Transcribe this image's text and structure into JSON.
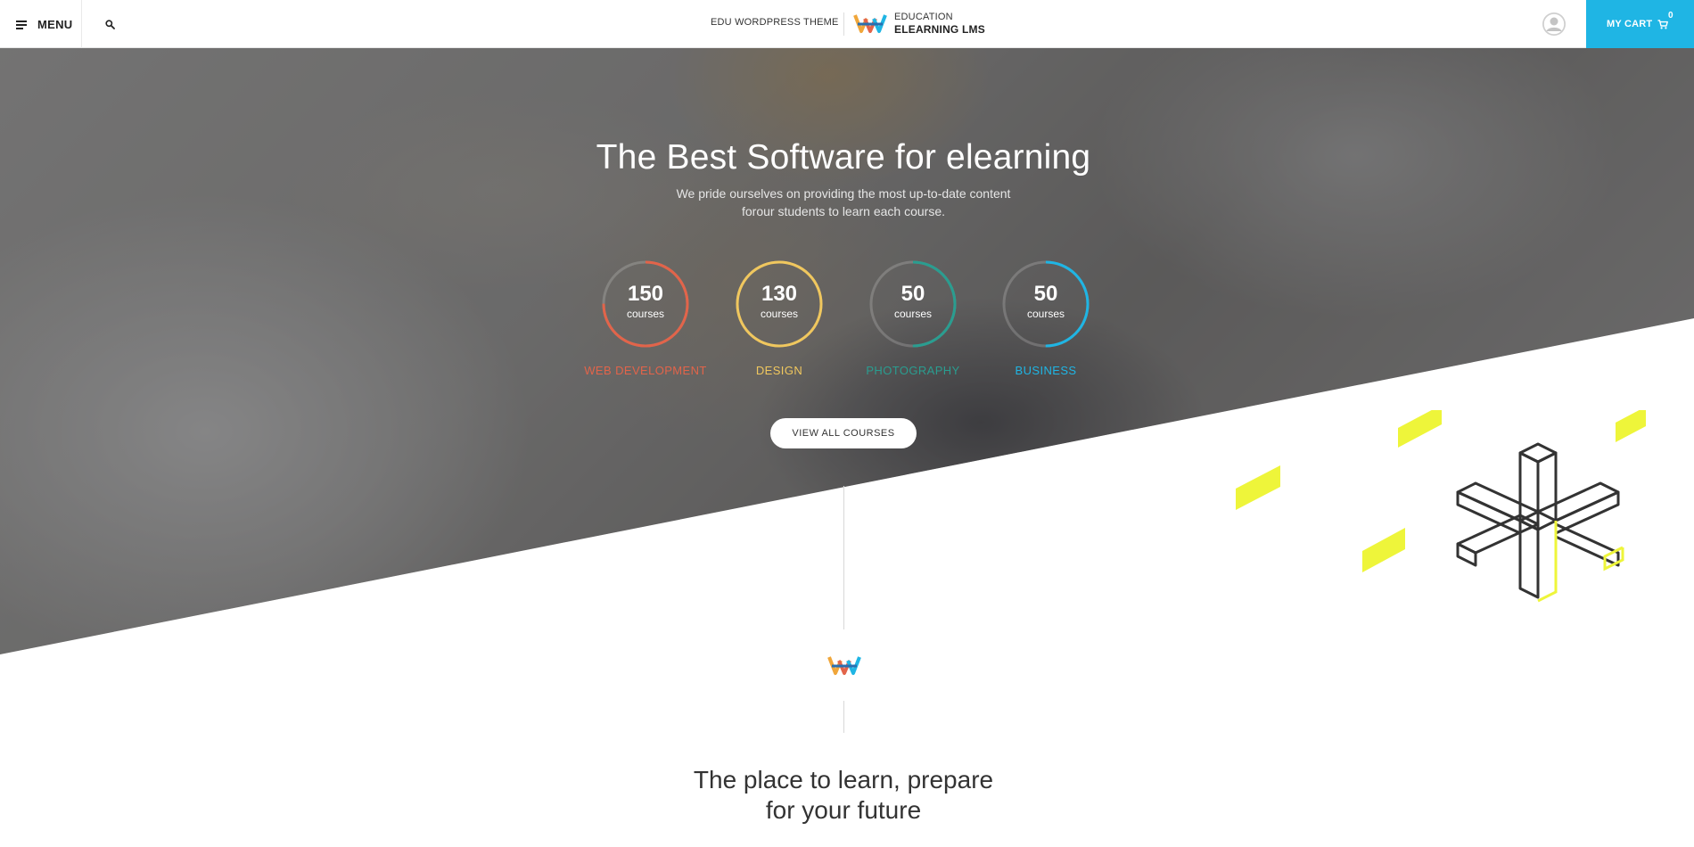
{
  "header": {
    "menu_label": "MENU",
    "tagline": "EDU WORDPRESS THEME",
    "logo_line1": "EDUCATION",
    "logo_line2": "ELEARNING LMS",
    "cart_label": "MY CART",
    "cart_count": "0",
    "accent_color": "#1fb5e4"
  },
  "hero": {
    "title": "The Best Software for elearning",
    "subtitle_line1": "We pride ourselves on providing the most up-to-date content",
    "subtitle_line2": "forour students to learn each course.",
    "button_label": "VIEW ALL COURSES",
    "stats": [
      {
        "number": "150",
        "unit": "courses",
        "label": "WEB DEVELOPMENT",
        "color": "#e2644a",
        "progress": 0.75
      },
      {
        "number": "130",
        "unit": "courses",
        "label": "DESIGN",
        "color": "#f0c75e",
        "progress": 1.0
      },
      {
        "number": "50",
        "unit": "courses",
        "label": "PHOTOGRAPHY",
        "color": "#2a9d90",
        "progress": 0.5
      },
      {
        "number": "50",
        "unit": "courses",
        "label": "BUSINESS",
        "color": "#1fb5e4",
        "progress": 0.5
      }
    ]
  },
  "intro": {
    "title_line1": "The place to learn, prepare",
    "title_line2": "for your future"
  }
}
